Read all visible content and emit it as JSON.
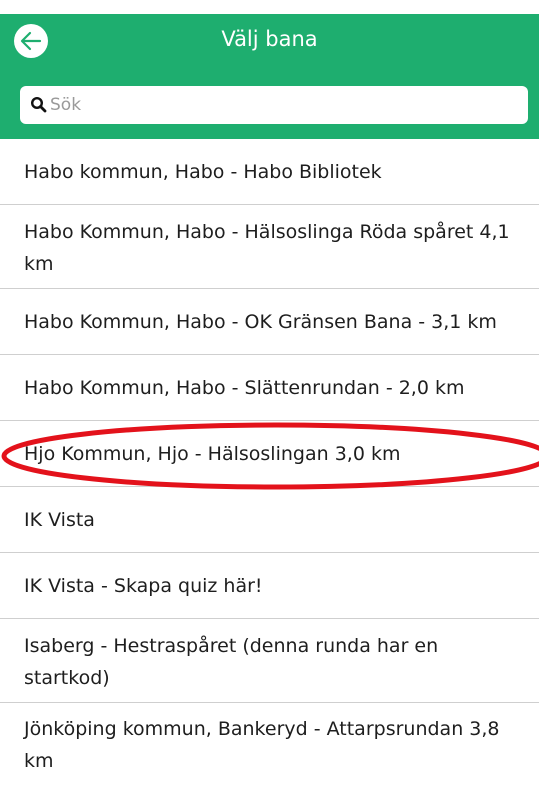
{
  "header": {
    "title": "Välj bana",
    "back_icon": "arrow-left-icon",
    "color": "#1eae6f"
  },
  "search": {
    "placeholder": "Sök",
    "value": "",
    "icon": "search-icon"
  },
  "courses": [
    "Habo kommun, Habo - Habo Bibliotek",
    "Habo Kommun, Habo - Hälsoslinga Röda spåret 4,1 km",
    "Habo Kommun, Habo - OK Gränsen Bana  - 3,1 km",
    "Habo Kommun, Habo - Slättenrundan - 2,0 km",
    "Hjo Kommun, Hjo - Hälsoslingan 3,0 km",
    "IK Vista",
    "IK Vista - Skapa quiz här!",
    "Isaberg - Hestraspåret (denna runda har en startkod)",
    "Jönköping kommun, Bankeryd - Attarpsrundan 3,8 km"
  ],
  "annotation": {
    "highlight_color": "#e3121b"
  }
}
